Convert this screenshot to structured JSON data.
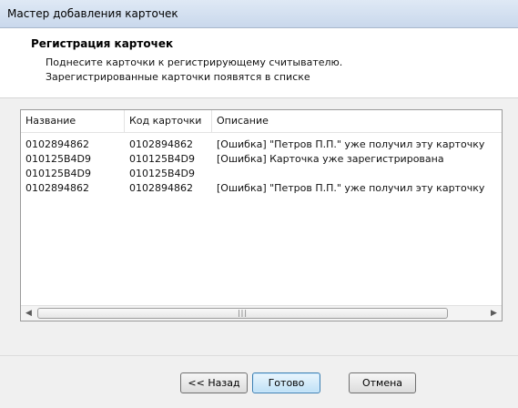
{
  "window": {
    "title": "Мастер добавления карточек"
  },
  "header": {
    "title": "Регистрация карточек",
    "line1": "Поднесите карточки к регистрирующему считывателю.",
    "line2": "Зарегистрированные карточки появятся в списке"
  },
  "list": {
    "columns": [
      "Название",
      "Код карточки",
      "Описание"
    ],
    "rows": [
      [
        "0102894862",
        "0102894862",
        "[Ошибка] \"Петров П.П.\" уже получил эту карточку"
      ],
      [
        "010125B4D9",
        "010125B4D9",
        "[Ошибка] Карточка уже зарегистрирована"
      ],
      [
        "010125B4D9",
        "010125B4D9",
        ""
      ],
      [
        "0102894862",
        "0102894862",
        "[Ошибка] \"Петров П.П.\" уже получил эту карточку"
      ]
    ]
  },
  "buttons": {
    "back": "<< Назад",
    "done": "Готово",
    "cancel": "Отмена"
  },
  "icons": {
    "scroll_left": "triangle-left",
    "scroll_right": "triangle-right",
    "scroll_grip": "grip"
  }
}
